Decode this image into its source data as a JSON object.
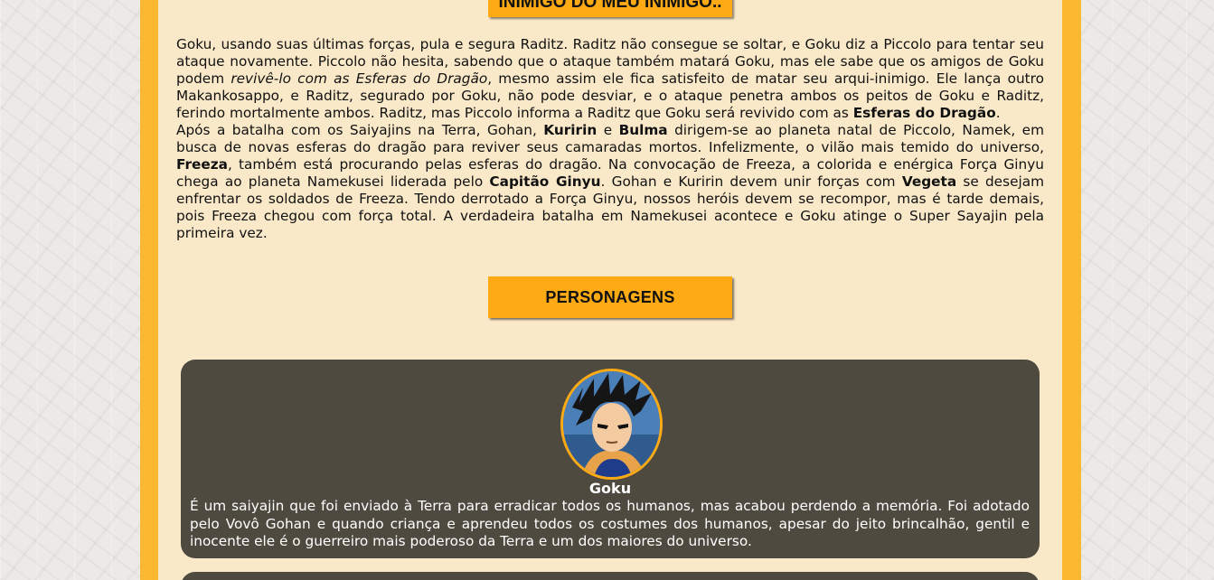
{
  "section_button_top": "INIMIGO DO MEU INIMIGO..",
  "story": {
    "p1_part1": "Goku, usando suas últimas forças, pula e segura Raditz. Raditz não consegue se soltar, e Goku diz a Piccolo para tentar seu ataque novamente. Piccolo não hesita, sabendo que o ataque também matará Goku, mas ele sabe que os amigos de Goku podem ",
    "p1_italic": "revivê-lo com as Esferas do Dragão",
    "p1_part2": ", mesmo assim ele fica satisfeito de matar seu arqui-inimigo. Ele lança outro Makankosappo, e Raditz, segurado por Goku, não pode desviar, e o ataque penetra ambos os peitos de Goku e Raditz, ferindo mortalmente ambos. Raditz, mas Piccolo informa a Raditz que Goku será revivido com as ",
    "p1_bold": "Esferas do Dragão",
    "p1_end": ".",
    "p2_part1": "Após a batalha com os Saiyajins na Terra, Gohan, ",
    "p2_bold1": "Kuririn",
    "p2_part2": " e ",
    "p2_bold2": "Bulma",
    "p2_part3": " dirigem-se ao planeta natal de Piccolo, Namek, em busca de novas esferas do dragão para reviver seus camaradas mortos. Infelizmente, o vilão mais temido do universo, ",
    "p2_bold3": "Freeza",
    "p2_part4": ", também está procurando pelas esferas do dragão. Na convocação de Freeza, a colorida e enérgica Força Ginyu chega ao planeta Namekusei liderada pelo ",
    "p2_bold4": "Capitão Ginyu",
    "p2_part5": ". Gohan e Kuririn devem unir forças com ",
    "p2_bold5": "Vegeta",
    "p2_part6": " se desejam enfrentar os soldados de Freeza. Tendo derrotado a Força Ginyu, nossos heróis devem se recompor, mas é tarde demais, pois Freeza chegou com força total. A verdadeira batalha em Namekusei acontece e Goku atinge o Super Sayajin pela primeira vez."
  },
  "characters_button": "PERSONAGENS",
  "characters": [
    {
      "name": "Goku",
      "description": "É um saiyajin que foi enviado à Terra para erradicar todos os humanos, mas acabou perdendo a memória. Foi adotado pelo Vovô Gohan e quando criança e aprendeu todos os costumes dos humanos, apesar do jeito brincalhão, gentil e inocente ele é o guerreiro mais poderoso da Terra e um dos maiores do universo."
    }
  ],
  "colors": {
    "frame": "#fdb832",
    "content_bg": "#fae9c9",
    "button": "#fdaa14",
    "card_bg": "#4e4a3f"
  }
}
